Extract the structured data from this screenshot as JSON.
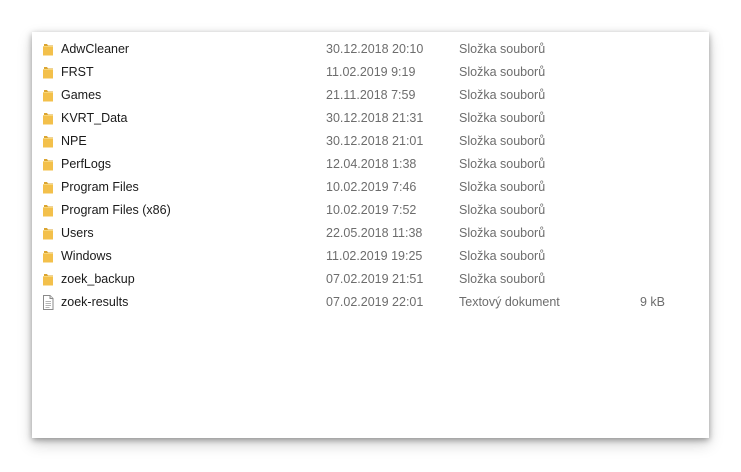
{
  "colors": {
    "folder": "#f3c04b",
    "folder_dark": "#dba531",
    "text_secondary": "#6d6d6d"
  },
  "files": [
    {
      "name": "AdwCleaner",
      "date": "30.12.2018 20:10",
      "type": "Složka souborů",
      "size": "",
      "icon": "folder-icon"
    },
    {
      "name": "FRST",
      "date": "11.02.2019 9:19",
      "type": "Složka souborů",
      "size": "",
      "icon": "folder-icon"
    },
    {
      "name": "Games",
      "date": "21.11.2018 7:59",
      "type": "Složka souborů",
      "size": "",
      "icon": "folder-icon"
    },
    {
      "name": "KVRT_Data",
      "date": "30.12.2018 21:31",
      "type": "Složka souborů",
      "size": "",
      "icon": "folder-icon"
    },
    {
      "name": "NPE",
      "date": "30.12.2018 21:01",
      "type": "Složka souborů",
      "size": "",
      "icon": "folder-icon"
    },
    {
      "name": "PerfLogs",
      "date": "12.04.2018 1:38",
      "type": "Složka souborů",
      "size": "",
      "icon": "folder-icon"
    },
    {
      "name": "Program Files",
      "date": "10.02.2019 7:46",
      "type": "Složka souborů",
      "size": "",
      "icon": "folder-icon"
    },
    {
      "name": "Program Files (x86)",
      "date": "10.02.2019 7:52",
      "type": "Složka souborů",
      "size": "",
      "icon": "folder-icon"
    },
    {
      "name": "Users",
      "date": "22.05.2018 11:38",
      "type": "Složka souborů",
      "size": "",
      "icon": "folder-icon"
    },
    {
      "name": "Windows",
      "date": "11.02.2019 19:25",
      "type": "Složka souborů",
      "size": "",
      "icon": "folder-icon"
    },
    {
      "name": "zoek_backup",
      "date": "07.02.2019 21:51",
      "type": "Složka souborů",
      "size": "",
      "icon": "folder-icon"
    },
    {
      "name": "zoek-results",
      "date": "07.02.2019 22:01",
      "type": "Textový dokument",
      "size": "9 kB",
      "icon": "text-document-icon"
    }
  ]
}
